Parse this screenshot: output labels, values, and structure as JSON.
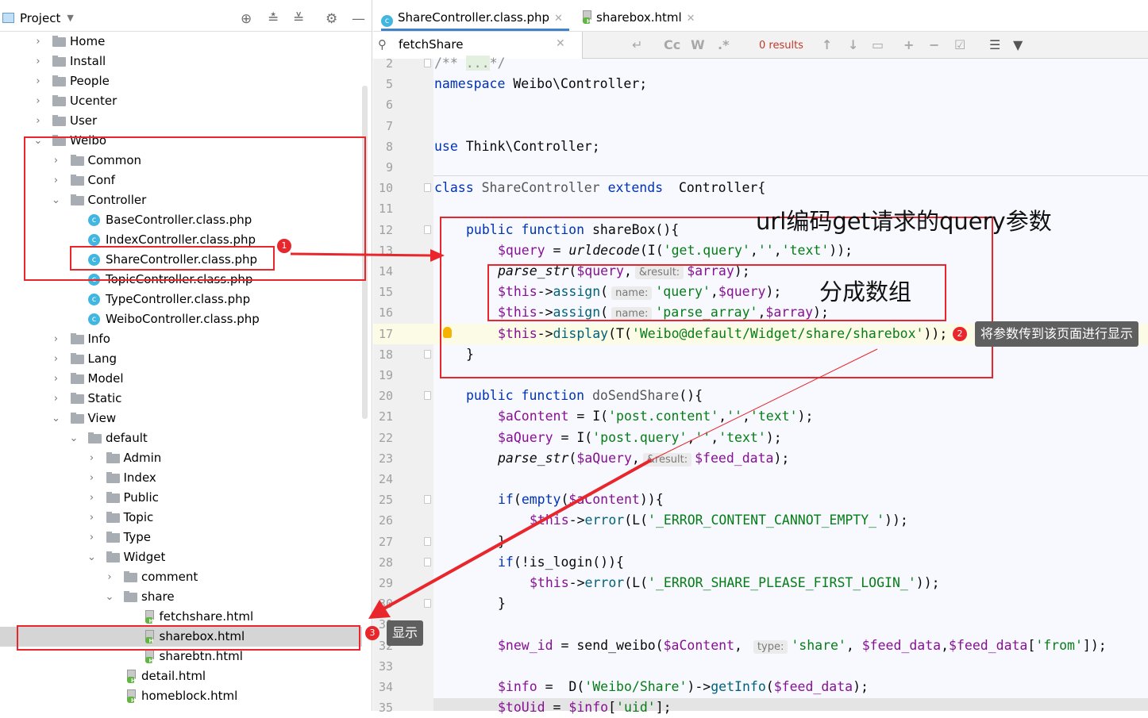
{
  "project_panel": {
    "title": "Project",
    "tree": [
      {
        "level": 0,
        "type": "folder",
        "label": "Home",
        "expanded": false
      },
      {
        "level": 0,
        "type": "folder",
        "label": "Install",
        "expanded": false
      },
      {
        "level": 0,
        "type": "folder",
        "label": "People",
        "expanded": false
      },
      {
        "level": 0,
        "type": "folder",
        "label": "Ucenter",
        "expanded": false
      },
      {
        "level": 0,
        "type": "folder",
        "label": "User",
        "expanded": false
      },
      {
        "level": 0,
        "type": "folder",
        "label": "Weibo",
        "expanded": true
      },
      {
        "level": 1,
        "type": "folder",
        "label": "Common",
        "expanded": false
      },
      {
        "level": 1,
        "type": "folder",
        "label": "Conf",
        "expanded": false
      },
      {
        "level": 1,
        "type": "folder",
        "label": "Controller",
        "expanded": true
      },
      {
        "level": 2,
        "type": "php",
        "label": "BaseController.class.php"
      },
      {
        "level": 2,
        "type": "php",
        "label": "IndexController.class.php"
      },
      {
        "level": 2,
        "type": "php",
        "label": "ShareController.class.php"
      },
      {
        "level": 2,
        "type": "php",
        "label": "TopicController.class.php"
      },
      {
        "level": 2,
        "type": "php",
        "label": "TypeController.class.php"
      },
      {
        "level": 2,
        "type": "php",
        "label": "WeiboController.class.php"
      },
      {
        "level": 1,
        "type": "folder",
        "label": "Info",
        "expanded": false
      },
      {
        "level": 1,
        "type": "folder",
        "label": "Lang",
        "expanded": false
      },
      {
        "level": 1,
        "type": "folder",
        "label": "Model",
        "expanded": false
      },
      {
        "level": 1,
        "type": "folder",
        "label": "Static",
        "expanded": false
      },
      {
        "level": 1,
        "type": "folder",
        "label": "View",
        "expanded": true
      },
      {
        "level": 2,
        "type": "folder",
        "label": "default",
        "expanded": true
      },
      {
        "level": 3,
        "type": "folder",
        "label": "Admin",
        "expanded": false
      },
      {
        "level": 3,
        "type": "folder",
        "label": "Index",
        "expanded": false
      },
      {
        "level": 3,
        "type": "folder",
        "label": "Public",
        "expanded": false
      },
      {
        "level": 3,
        "type": "folder",
        "label": "Topic",
        "expanded": false
      },
      {
        "level": 3,
        "type": "folder",
        "label": "Type",
        "expanded": false
      },
      {
        "level": 3,
        "type": "folder",
        "label": "Widget",
        "expanded": true
      },
      {
        "level": 4,
        "type": "folder",
        "label": "comment",
        "expanded": false
      },
      {
        "level": 4,
        "type": "folder",
        "label": "share",
        "expanded": true
      },
      {
        "level": 5,
        "type": "html",
        "label": "fetchshare.html"
      },
      {
        "level": 5,
        "type": "html",
        "label": "sharebox.html",
        "selected": true
      },
      {
        "level": 5,
        "type": "html",
        "label": "sharebtn.html"
      },
      {
        "level": 4,
        "type": "html",
        "label": "detail.html"
      },
      {
        "level": 4,
        "type": "html",
        "label": "homeblock.html"
      }
    ]
  },
  "tabs": [
    {
      "label": "ShareController.class.php",
      "icon": "php-class-icon",
      "active": true
    },
    {
      "label": "sharebox.html",
      "icon": "html-file-icon",
      "active": false
    }
  ],
  "search": {
    "query": "fetchShare",
    "results": "0 results",
    "case_label": "Cc",
    "words_label": "W",
    "regex_label": ".*"
  },
  "editor": {
    "current_line": 17,
    "lines": [
      {
        "n": "2",
        "indent": 0,
        "fold": true,
        "segs": [
          [
            "/** ",
            "c"
          ],
          [
            "...",
            "c cg"
          ],
          [
            "*/",
            "c"
          ]
        ]
      },
      {
        "n": "5",
        "indent": 0,
        "segs": [
          [
            "namespace",
            "k"
          ],
          [
            " Weibo\\Controller;",
            ""
          ]
        ]
      },
      {
        "n": "6",
        "indent": 0,
        "segs": []
      },
      {
        "n": "7",
        "indent": 0,
        "segs": []
      },
      {
        "n": "8",
        "indent": 0,
        "segs": [
          [
            "use",
            "k"
          ],
          [
            " Think\\Controller;",
            ""
          ]
        ]
      },
      {
        "n": "9",
        "indent": 0,
        "segs": []
      },
      {
        "n": "10",
        "indent": 0,
        "fold": true,
        "segs": [
          [
            "class",
            "k"
          ],
          [
            " ShareController ",
            "f"
          ],
          [
            "extends",
            "k"
          ],
          [
            "  Controller{",
            ""
          ]
        ]
      },
      {
        "n": "11",
        "indent": 0,
        "segs": []
      },
      {
        "n": "12",
        "indent": 1,
        "fold": true,
        "segs": [
          [
            "public function",
            "k"
          ],
          [
            " shareBox",
            ""
          ],
          [
            "(){",
            ""
          ]
        ]
      },
      {
        "n": "13",
        "indent": 2,
        "segs": [
          [
            "$query",
            "v"
          ],
          [
            " = ",
            ""
          ],
          [
            "urldecode",
            "i"
          ],
          [
            "(I(",
            ""
          ],
          [
            "'get.query'",
            "s"
          ],
          [
            ",",
            ""
          ],
          [
            "''",
            "s"
          ],
          [
            ",",
            ""
          ],
          [
            "'text'",
            "s"
          ],
          [
            "));",
            ""
          ]
        ]
      },
      {
        "n": "14",
        "indent": 2,
        "segs": [
          [
            "parse_str",
            "i"
          ],
          [
            "(",
            ""
          ],
          [
            "$query",
            "v"
          ],
          [
            ",",
            ""
          ],
          [
            "&result:",
            "h"
          ],
          [
            "$array",
            "v"
          ],
          [
            ");",
            ""
          ]
        ]
      },
      {
        "n": "15",
        "indent": 2,
        "segs": [
          [
            "$this",
            "v"
          ],
          [
            "->",
            ""
          ],
          [
            "assign",
            "m"
          ],
          [
            "(",
            ""
          ],
          [
            "name:",
            "h"
          ],
          [
            "'query'",
            "s"
          ],
          [
            ",",
            ""
          ],
          [
            "$query",
            "v"
          ],
          [
            ");",
            ""
          ]
        ]
      },
      {
        "n": "16",
        "indent": 2,
        "segs": [
          [
            "$this",
            "v"
          ],
          [
            "->",
            ""
          ],
          [
            "assign",
            "m"
          ],
          [
            "(",
            ""
          ],
          [
            "name:",
            "h"
          ],
          [
            "'parse_array'",
            "s"
          ],
          [
            ",",
            ""
          ],
          [
            "$array",
            "v"
          ],
          [
            ");",
            ""
          ]
        ]
      },
      {
        "n": "17",
        "indent": 2,
        "bulb": true,
        "segs": [
          [
            "$this",
            "v"
          ],
          [
            "->",
            ""
          ],
          [
            "display",
            "m"
          ],
          [
            "(T(",
            ""
          ],
          [
            "'Weibo@default/Widget/share/sharebox'",
            "s"
          ],
          [
            "));",
            ""
          ]
        ]
      },
      {
        "n": "18",
        "indent": 1,
        "fold": true,
        "segs": [
          [
            "}",
            ""
          ]
        ]
      },
      {
        "n": "19",
        "indent": 0,
        "segs": []
      },
      {
        "n": "20",
        "indent": 1,
        "fold": true,
        "segs": [
          [
            "public function",
            "k"
          ],
          [
            " doSendShare",
            "f"
          ],
          [
            "(){",
            ""
          ]
        ]
      },
      {
        "n": "21",
        "indent": 2,
        "segs": [
          [
            "$aContent",
            "v"
          ],
          [
            " = I(",
            ""
          ],
          [
            "'post.content'",
            "s"
          ],
          [
            ",",
            ""
          ],
          [
            "''",
            "s"
          ],
          [
            ",",
            ""
          ],
          [
            "'text'",
            "s"
          ],
          [
            ");",
            ""
          ]
        ]
      },
      {
        "n": "22",
        "indent": 2,
        "segs": [
          [
            "$aQuery",
            "v"
          ],
          [
            " = I(",
            ""
          ],
          [
            "'post.query'",
            "s"
          ],
          [
            ",",
            ""
          ],
          [
            "''",
            "s"
          ],
          [
            ",",
            ""
          ],
          [
            "'text'",
            "s"
          ],
          [
            ");",
            ""
          ]
        ]
      },
      {
        "n": "23",
        "indent": 2,
        "segs": [
          [
            "parse_str",
            "i"
          ],
          [
            "(",
            ""
          ],
          [
            "$aQuery",
            "v"
          ],
          [
            ",",
            ""
          ],
          [
            "&result:",
            "h"
          ],
          [
            "$feed_data",
            "v"
          ],
          [
            ");",
            ""
          ]
        ]
      },
      {
        "n": "24",
        "indent": 0,
        "segs": []
      },
      {
        "n": "25",
        "indent": 2,
        "fold": true,
        "segs": [
          [
            "if",
            "k"
          ],
          [
            "(",
            ""
          ],
          [
            "empty",
            "k"
          ],
          [
            "(",
            ""
          ],
          [
            "$aContent",
            "v"
          ],
          [
            ")){",
            ""
          ]
        ]
      },
      {
        "n": "26",
        "indent": 3,
        "segs": [
          [
            "$this",
            "v"
          ],
          [
            "->",
            ""
          ],
          [
            "error",
            "m"
          ],
          [
            "(L(",
            ""
          ],
          [
            "'_ERROR_CONTENT_CANNOT_EMPTY_'",
            "s"
          ],
          [
            "));",
            ""
          ]
        ]
      },
      {
        "n": "27",
        "indent": 2,
        "fold": true,
        "segs": [
          [
            "}",
            ""
          ]
        ]
      },
      {
        "n": "28",
        "indent": 2,
        "fold": true,
        "segs": [
          [
            "if",
            "k"
          ],
          [
            "(!is_login()){",
            ""
          ]
        ]
      },
      {
        "n": "29",
        "indent": 3,
        "segs": [
          [
            "$this",
            "v"
          ],
          [
            "->",
            ""
          ],
          [
            "error",
            "m"
          ],
          [
            "(L(",
            ""
          ],
          [
            "'_ERROR_SHARE_PLEASE_FIRST_LOGIN_'",
            "s"
          ],
          [
            "));",
            ""
          ]
        ]
      },
      {
        "n": "30",
        "indent": 2,
        "fold": true,
        "segs": [
          [
            "}",
            ""
          ]
        ]
      },
      {
        "n": "31",
        "indent": 0,
        "segs": []
      },
      {
        "n": "32",
        "indent": 2,
        "segs": [
          [
            "$new_id",
            "v"
          ],
          [
            " = send_weibo(",
            ""
          ],
          [
            "$aContent",
            "v"
          ],
          [
            ", ",
            ""
          ],
          [
            "type:",
            "h"
          ],
          [
            "'share'",
            "s"
          ],
          [
            ", ",
            ""
          ],
          [
            "$feed_data",
            "v"
          ],
          [
            ",",
            ""
          ],
          [
            "$feed_data",
            "v"
          ],
          [
            "[",
            ""
          ],
          [
            "'from'",
            "s"
          ],
          [
            "]);",
            ""
          ]
        ]
      },
      {
        "n": "33",
        "indent": 0,
        "segs": []
      },
      {
        "n": "34",
        "indent": 2,
        "segs": [
          [
            "$info",
            "v"
          ],
          [
            " =  D(",
            ""
          ],
          [
            "'Weibo/Share'",
            "s"
          ],
          [
            ")->",
            ""
          ],
          [
            "getInfo",
            "m"
          ],
          [
            "(",
            ""
          ],
          [
            "$feed_data",
            "v"
          ],
          [
            ");",
            ""
          ]
        ]
      },
      {
        "n": "35",
        "indent": 2,
        "segs": [
          [
            "$toUid",
            "v"
          ],
          [
            " = ",
            ""
          ],
          [
            "$info",
            "v"
          ],
          [
            "[",
            ""
          ],
          [
            "'uid'",
            "s"
          ],
          [
            "];",
            ""
          ]
        ]
      }
    ]
  },
  "annotations": {
    "badge1": "1",
    "badge2": "2",
    "badge3": "3",
    "note_query": "url编码get请求的query参数",
    "note_array": "分成数组",
    "tip_pass": "将参数传到该页面进行显示",
    "tip_show": "显示",
    "color": "#e8262b"
  }
}
